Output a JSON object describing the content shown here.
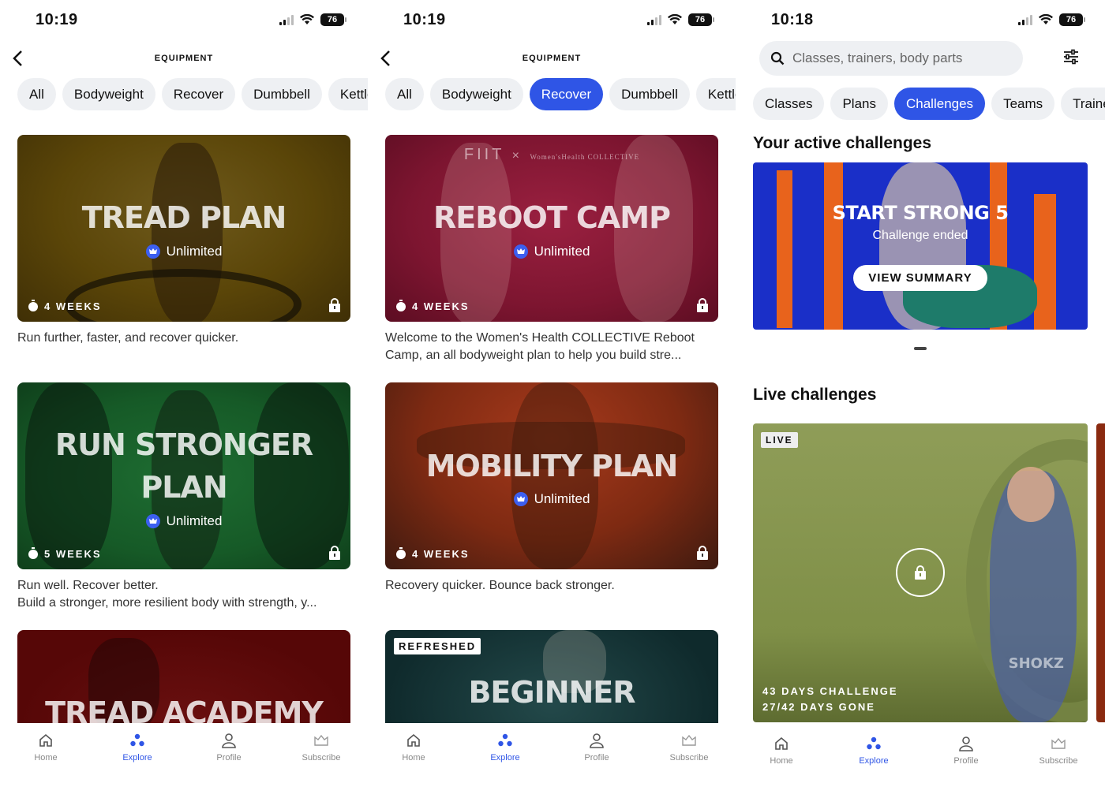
{
  "colors": {
    "accent": "#2f55e6"
  },
  "status": {
    "time_a": "10:19",
    "time_b": "10:19",
    "time_c": "10:18",
    "battery": "76"
  },
  "left": {
    "title": "EQUIPMENT",
    "chips": [
      "All",
      "Bodyweight",
      "Recover",
      "Dumbbell",
      "Kettle"
    ],
    "cards": [
      {
        "title": "TREAD PLAN",
        "badge": "Unlimited",
        "weeks": "4 WEEKS",
        "desc": "Run further, faster, and recover quicker."
      },
      {
        "title": "RUN STRONGER PLAN",
        "badge": "Unlimited",
        "weeks": "5 WEEKS",
        "desc": "Run well. Recover better.\nBuild a stronger, more resilient body with strength, y..."
      },
      {
        "title": "TREAD ACADEMY"
      }
    ]
  },
  "middle": {
    "title": "EQUIPMENT",
    "chips": [
      "All",
      "Bodyweight",
      "Recover",
      "Dumbbell",
      "Kettle"
    ],
    "active_chip": "Recover",
    "cards": [
      {
        "title": "REBOOT CAMP",
        "brand": "FIIT",
        "brand2": "Women'sHealth COLLECTIVE",
        "badge": "Unlimited",
        "weeks": "4 WEEKS",
        "desc": "Welcome to the Women's Health COLLECTIVE Reboot Camp, an all bodyweight plan to help you build stre..."
      },
      {
        "title": "MOBILITY PLAN",
        "badge": "Unlimited",
        "weeks": "4 WEEKS",
        "desc": "Recovery quicker. Bounce back stronger."
      },
      {
        "title": "BEGINNER",
        "tag": "REFRESHED"
      }
    ]
  },
  "right": {
    "search_placeholder": "Classes, trainers, body parts",
    "chips": [
      "Classes",
      "Plans",
      "Challenges",
      "Teams",
      "Trainer"
    ],
    "active_chip": "Challenges",
    "active_section": "Your active challenges",
    "active_card": {
      "title": "START STRONG 5",
      "subtitle": "Challenge ended",
      "button": "VIEW SUMMARY"
    },
    "live_section": "Live challenges",
    "live_card": {
      "tag": "LIVE",
      "brand": "SHOKZ",
      "line1": "43 DAYS CHALLENGE",
      "line2": "27/42 DAYS GONE"
    }
  },
  "tabs": [
    {
      "label": "Home",
      "icon": "home-icon"
    },
    {
      "label": "Explore",
      "icon": "explore-icon"
    },
    {
      "label": "Profile",
      "icon": "profile-icon"
    },
    {
      "label": "Subscribe",
      "icon": "subscribe-icon"
    }
  ]
}
